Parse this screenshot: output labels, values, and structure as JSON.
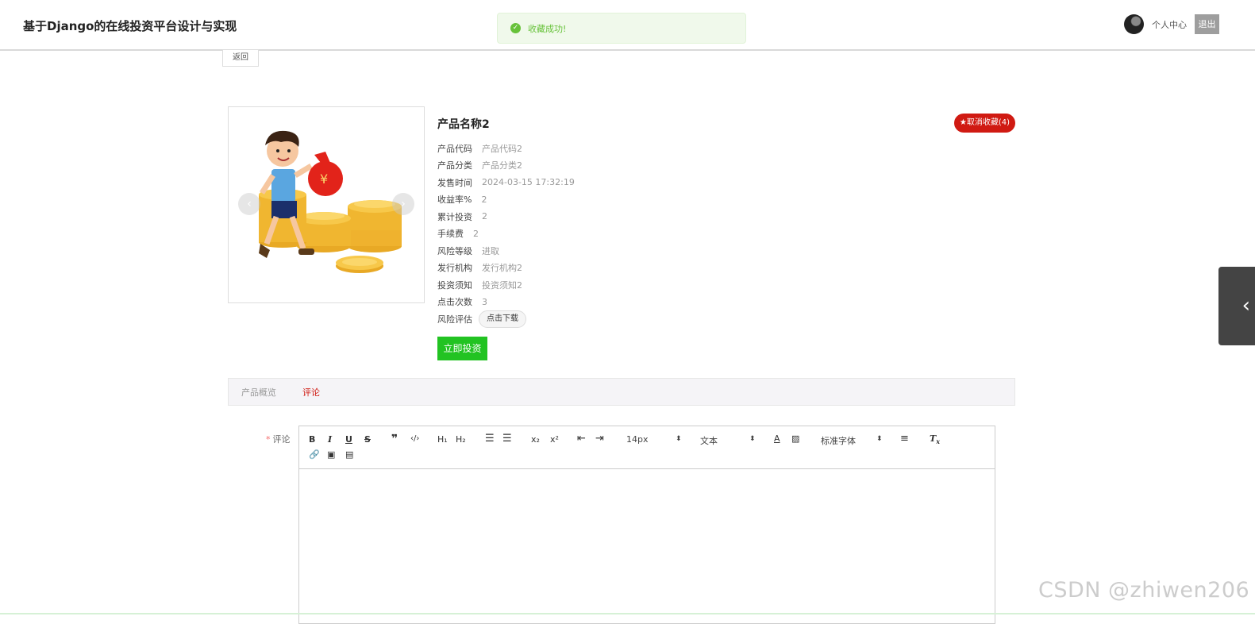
{
  "header": {
    "site_title": "基于Django的在线投资平台设计与实现",
    "toast": "收藏成功!",
    "user_center": "个人中心",
    "logout": "退出"
  },
  "back_label": "返回",
  "product": {
    "name": "产品名称2",
    "favorite_button": "★取消收藏(4)",
    "fields": [
      {
        "label": "产品代码",
        "value": "产品代码2"
      },
      {
        "label": "产品分类",
        "value": "产品分类2"
      },
      {
        "label": "发售时间",
        "value": "2024-03-15 17:32:19"
      },
      {
        "label": "收益率%",
        "value": "2"
      },
      {
        "label": "累计投资",
        "value": "2"
      },
      {
        "label": "手续费",
        "value": "2"
      },
      {
        "label": "风险等级",
        "value": "进取"
      },
      {
        "label": "发行机构",
        "value": "发行机构2"
      },
      {
        "label": "投资须知",
        "value": "投资须知2"
      },
      {
        "label": "点击次数",
        "value": "3"
      }
    ],
    "risk_label": "风险评估",
    "download_label": "点击下载",
    "invest_label": "立即投资"
  },
  "tabs": [
    {
      "label": "产品概览",
      "active": false
    },
    {
      "label": "评论",
      "active": true
    }
  ],
  "comment": {
    "required_mark": "*",
    "label": "评论",
    "font_size": "14px",
    "block_type": "文本",
    "font_family": "标准字体"
  },
  "watermark": "CSDN @zhiwen206",
  "colors": {
    "accent_red": "#d01a12",
    "success_green": "#22c322",
    "toast_green": "#67c23a"
  }
}
